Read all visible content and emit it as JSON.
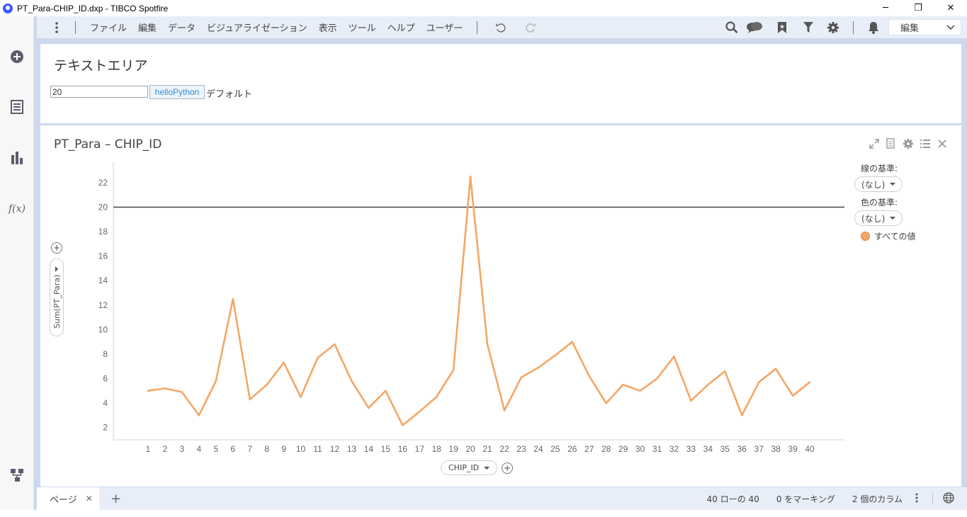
{
  "window": {
    "title": "PT_Para-CHIP_ID.dxp - TIBCO Spotfire",
    "minimize": "─",
    "restore": "❐",
    "close": "✕"
  },
  "menu": {
    "items": [
      "ファイル",
      "編集",
      "データ",
      "ビジュアライゼーション",
      "表示",
      "ツール",
      "ヘルプ",
      "ユーザー"
    ],
    "mode": "編集"
  },
  "textarea": {
    "title": "テキストエリア",
    "input_value": "20",
    "button_label": "helloPython",
    "label": "デフォルト"
  },
  "viz": {
    "title": "PT_Para – CHIP_ID",
    "y_axis_selector": "Sum(PT_Para)",
    "x_axis_selector": "CHIP_ID",
    "line_by_label": "線の基準:",
    "line_by_value": "(なし)",
    "color_by_label": "色の基準:",
    "color_by_value": "(なし)",
    "legend_item": "すべての値"
  },
  "chart_data": {
    "type": "line",
    "x": [
      1,
      2,
      3,
      4,
      5,
      6,
      7,
      8,
      9,
      10,
      11,
      12,
      13,
      14,
      15,
      16,
      17,
      18,
      19,
      20,
      21,
      22,
      23,
      24,
      25,
      26,
      27,
      28,
      29,
      30,
      31,
      32,
      33,
      34,
      35,
      36,
      37,
      38,
      39,
      40
    ],
    "series": [
      {
        "values": [
          5.0,
          5.2,
          4.9,
          3.0,
          5.8,
          12.5,
          4.3,
          5.5,
          7.3,
          4.5,
          7.7,
          8.8,
          5.8,
          3.6,
          5.0,
          2.2,
          3.3,
          4.5,
          6.7,
          22.5,
          8.8,
          3.4,
          6.1,
          6.9,
          7.9,
          9.0,
          6.2,
          4.0,
          5.5,
          5.0,
          6.0,
          7.8,
          4.2,
          5.5,
          6.6,
          3.0,
          5.7,
          6.8,
          4.6,
          5.7
        ],
        "color": "#f3a765"
      }
    ],
    "reference_line": 20,
    "reference_line_color": "#444444",
    "ylim": [
      1.0,
      23.5
    ],
    "yticks": [
      2,
      4,
      6,
      8,
      10,
      12,
      14,
      16,
      18,
      20,
      22
    ],
    "xlabel": "CHIP_ID",
    "ylabel": "Sum(PT_Para)",
    "grid": false,
    "legend": "right"
  },
  "status": {
    "page_tab": "ページ",
    "rows": "40 ローの 40",
    "marked": "0 をマーキング",
    "columns": "2 個のカラム"
  },
  "colors": {
    "accent": "#3d5afe",
    "line": "#f3a765",
    "menubar": "#e8eef8",
    "frame": "#cdd8ec"
  }
}
